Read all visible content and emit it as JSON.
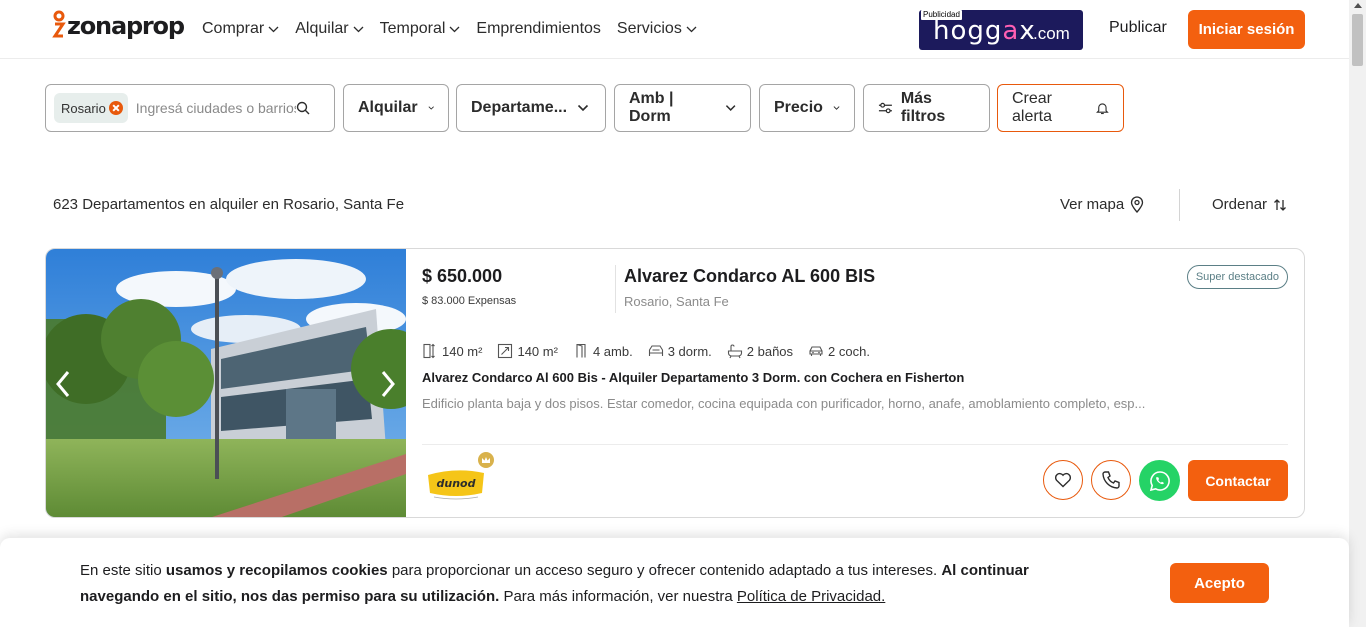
{
  "header": {
    "logo_text": "zonaprop",
    "nav": [
      {
        "label": "Comprar",
        "has_dropdown": true
      },
      {
        "label": "Alquilar",
        "has_dropdown": true
      },
      {
        "label": "Temporal",
        "has_dropdown": true
      },
      {
        "label": "Emprendimientos",
        "has_dropdown": false
      },
      {
        "label": "Servicios",
        "has_dropdown": true
      }
    ],
    "ad": {
      "tag": "Publicidad",
      "brand_part1": "hogg",
      "brand_accent": "a",
      "brand_part2": "x",
      "tld": ".com"
    },
    "publish_label": "Publicar",
    "login_label": "Iniciar sesión"
  },
  "filters": {
    "chip": "Rosario",
    "search_placeholder": "Ingresá ciudades o barrios",
    "operation": "Alquilar",
    "property_type": "Departame...",
    "rooms": "Amb | Dorm",
    "price": "Precio",
    "more_filters": "Más filtros",
    "create_alert": "Crear alerta"
  },
  "results": {
    "count_text": "623 Departamentos en alquiler en Rosario, Santa Fe",
    "map_label": "Ver mapa",
    "sort_label": "Ordenar"
  },
  "listing": {
    "price": "$ 650.000",
    "expenses": "$ 83.000 Expensas",
    "address": "Alvarez Condarco AL 600 BIS",
    "location": "Rosario, Santa Fe",
    "badge": "Super destacado",
    "features": [
      {
        "icon": "total-area-icon",
        "label": "140 m²"
      },
      {
        "icon": "covered-area-icon",
        "label": "140 m²"
      },
      {
        "icon": "door-icon",
        "label": "4 amb."
      },
      {
        "icon": "bed-icon",
        "label": "3 dorm."
      },
      {
        "icon": "bath-icon",
        "label": "2 baños"
      },
      {
        "icon": "car-icon",
        "label": "2 coch."
      }
    ],
    "title": "Alvarez Condarco Al 600 Bis - Alquiler Departamento 3 Dorm. con Cochera en Fisherton",
    "description": "Edificio planta baja y dos pisos. Estar comedor, cocina equipada con purificador, horno, anafe, amoblamiento completo, esp...",
    "publisher_logo_text": "dunod",
    "contact_label": "Contactar"
  },
  "cookie": {
    "text_1": "En este sitio ",
    "bold_1": "usamos y recopilamos cookies",
    "text_2": " para proporcionar un acceso seguro y ofrecer contenido adaptado a tus intereses. ",
    "bold_2": "Al continuar navegando en el sitio, nos das permiso para su utilización.",
    "text_3": " Para más información, ver nuestra ",
    "link": "Política de Privacidad.",
    "accept_label": "Acepto"
  },
  "colors": {
    "accent": "#f3600f",
    "whatsapp": "#25d366",
    "ad_bg": "#1c1a5c"
  }
}
